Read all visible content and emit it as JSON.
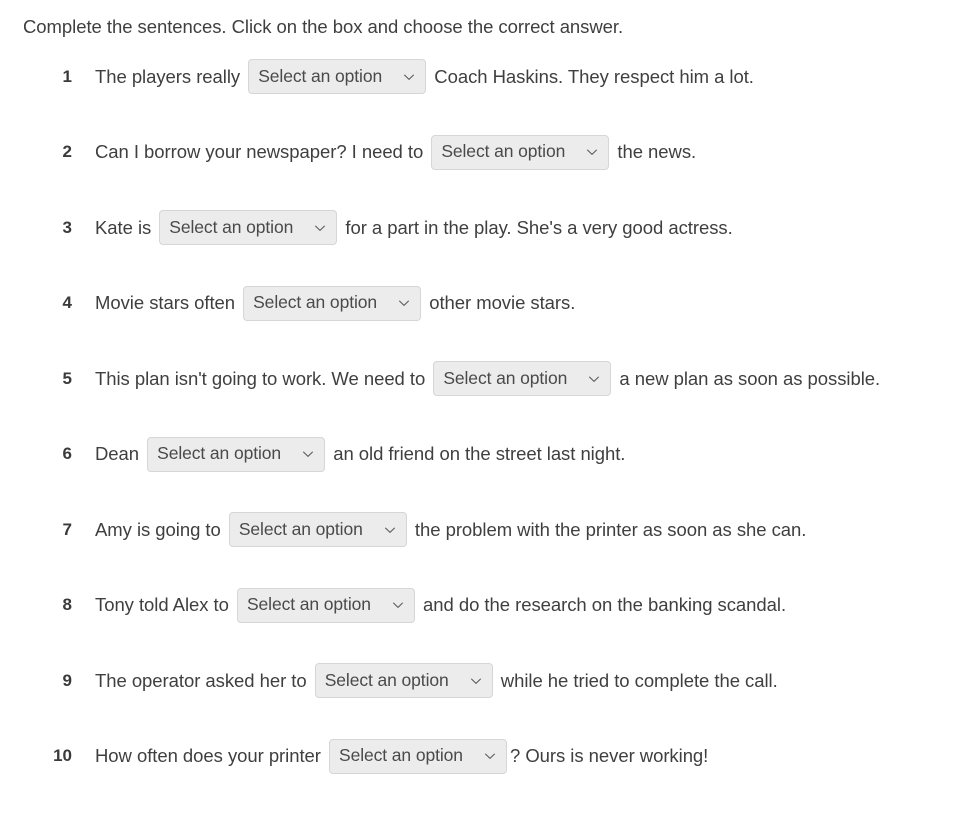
{
  "instructions": "Complete the sentences. Click on the box and choose the correct answer.",
  "select": {
    "placeholder": "Select an option",
    "chevron_icon": "chevron-down-icon",
    "background_color": "#ececec",
    "border_color": "#d6d6d6",
    "text_color": "#4a4a4a"
  },
  "page": {
    "background_color": "#ffffff",
    "text_color": "#3f3f3f"
  },
  "questions": [
    {
      "number": "1",
      "before": "The players really ",
      "after": " Coach Haskins. They respect him a lot.",
      "value": "Select an option"
    },
    {
      "number": "2",
      "before": "Can I borrow your newspaper? I need to ",
      "after": " the news.",
      "value": "Select an option"
    },
    {
      "number": "3",
      "before": "Kate is ",
      "after": " for a part in the play. She's a very good actress.",
      "value": "Select an option"
    },
    {
      "number": "4",
      "before": "Movie stars often ",
      "after": " other movie stars.",
      "value": "Select an option"
    },
    {
      "number": "5",
      "before": "This plan isn't going to work. We need to ",
      "after": " a new plan as soon as possible.",
      "value": "Select an option"
    },
    {
      "number": "6",
      "before": "Dean ",
      "after": " an old friend on the street last night.",
      "value": "Select an option"
    },
    {
      "number": "7",
      "before": "Amy is going to ",
      "after": " the problem with the printer as soon as she can.",
      "value": "Select an option"
    },
    {
      "number": "8",
      "before": "Tony told Alex to ",
      "after": " and do the research on the banking scandal.",
      "value": "Select an option"
    },
    {
      "number": "9",
      "before": "The operator asked her to ",
      "after": " while he tried to complete the call.",
      "value": "Select an option"
    },
    {
      "number": "10",
      "before": "How often does your printer ",
      "after": "? Ours is never working!",
      "value": "Select an option"
    }
  ]
}
